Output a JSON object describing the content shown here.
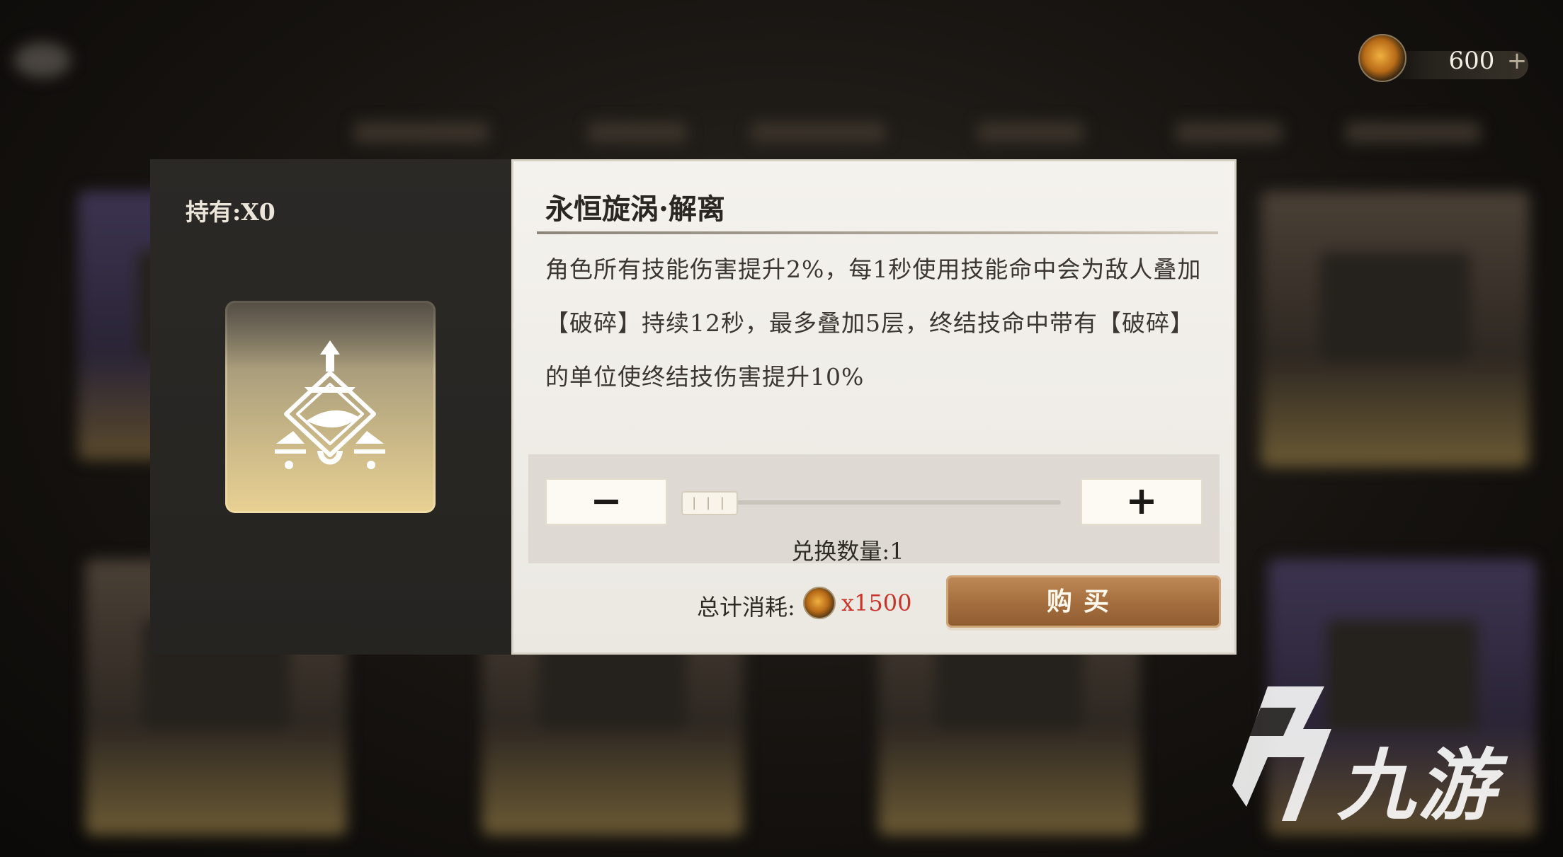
{
  "currency": {
    "amount": "600",
    "add_label": "+"
  },
  "item": {
    "owned_label": "持有:X0",
    "name": "永恒旋涡·解离",
    "description": "角色所有技能伤害提升2%，每1秒使用技能命中会为敌人叠加【破碎】持续12秒，最多叠加5层，终结技命中带有【破碎】的单位使终结技伤害提升10%",
    "icon": "vortex-rune-icon"
  },
  "quantity": {
    "minus_label": "−",
    "plus_label": "+",
    "handle_label": "| | |",
    "label": "兑换数量:1",
    "value": 1
  },
  "purchase": {
    "cost_label": "总计消耗:",
    "cost_value": "x1500",
    "buy_label": "购买"
  },
  "watermark": {
    "text": "九游"
  },
  "colors": {
    "accent_gold": "#e9d193",
    "cost_red": "#c9342a",
    "buy_brown": "#a66f3f"
  }
}
